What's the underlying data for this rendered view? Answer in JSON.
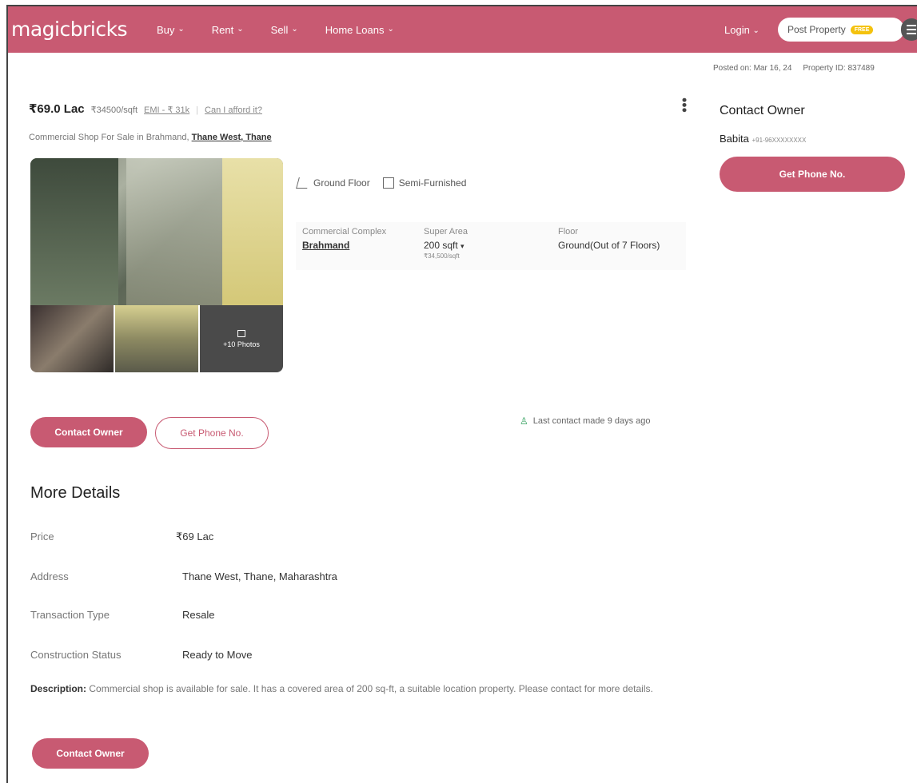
{
  "header": {
    "logo": "magicbricks",
    "nav": [
      "Buy",
      "Rent",
      "Sell",
      "Home Loans"
    ],
    "login": "Login",
    "post_property": "Post Property",
    "free_badge": "FREE"
  },
  "meta": {
    "posted": "Posted on: Mar 16, 24",
    "property_id": "Property ID: 837489"
  },
  "listing": {
    "price": "₹69.0 Lac",
    "per_sqft": "₹34500/sqft",
    "emi": "EMI - ₹ 31k",
    "afford": "Can I afford it?",
    "subtitle_prefix": "Commercial Shop For Sale in Brahmand,",
    "subtitle_location": "Thane West, Thane",
    "more_photos": "+10 Photos",
    "features": [
      "Ground Floor",
      "Semi-Furnished"
    ],
    "summary": {
      "complex_label": "Commercial Complex",
      "complex_value": "Brahmand",
      "area_label": "Super Area",
      "area_value": "200 sqft",
      "area_sub": "₹34,500/sqft",
      "floor_label": "Floor",
      "floor_value": "Ground(Out of 7 Floors)"
    },
    "contact_owner": "Contact Owner",
    "get_phone": "Get Phone No.",
    "last_contact": "Last contact made 9 days ago"
  },
  "more_details": {
    "title": "More Details",
    "rows": [
      {
        "label": "Price",
        "value": "₹69 Lac"
      },
      {
        "label": "Address",
        "value": "Thane West, Thane, Maharashtra"
      },
      {
        "label": "Transaction Type",
        "value": "Resale"
      },
      {
        "label": "Construction Status",
        "value": "Ready to Move"
      }
    ],
    "description_label": "Description:",
    "description": "Commercial shop is available for sale. It has a covered area of 200 sq-ft, a suitable location property. Please contact for more details.",
    "contact_owner": "Contact Owner"
  },
  "sidebar": {
    "title": "Contact Owner",
    "owner_name": "Babita",
    "owner_phone": "+91-96XXXXXXXX",
    "get_phone": "Get Phone No."
  },
  "colors": {
    "brand": "#c85a72",
    "accent_green": "#2e9e5b"
  }
}
